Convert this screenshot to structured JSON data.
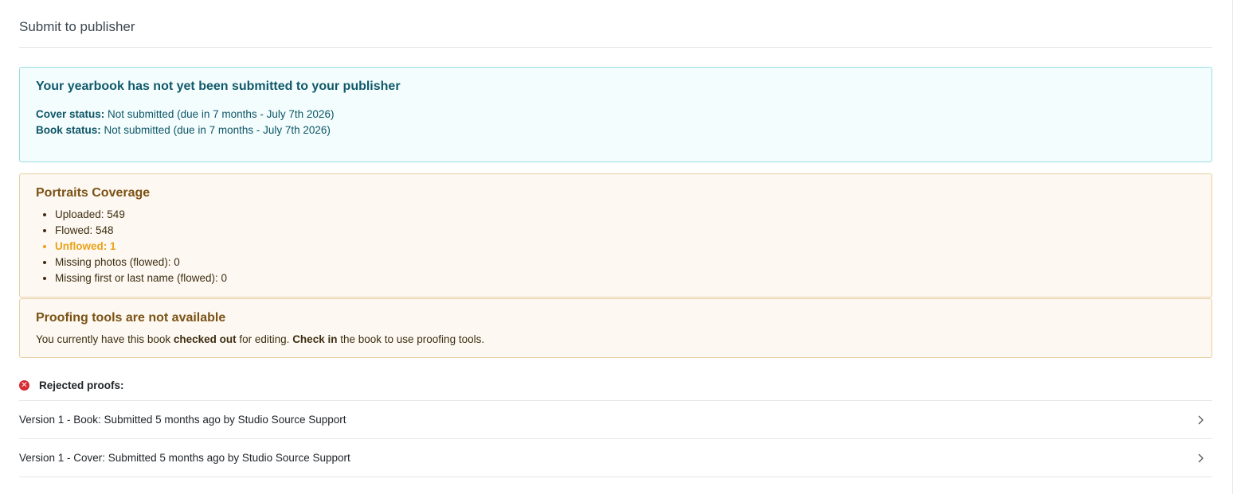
{
  "page": {
    "title": "Submit to publisher"
  },
  "submission": {
    "heading": "Your yearbook has not yet been submitted to your publisher",
    "cover_label": "Cover status:",
    "cover_value": "Not submitted (due in 7 months - July 7th 2026)",
    "book_label": "Book status:",
    "book_value": "Not submitted (due in 7 months - July 7th 2026)"
  },
  "coverage": {
    "heading": "Portraits Coverage",
    "items": [
      {
        "text": "Uploaded: 549"
      },
      {
        "text": "Flowed: 548"
      },
      {
        "text": "Unflowed: 1"
      },
      {
        "text": "Missing photos (flowed): 0"
      },
      {
        "text": "Missing first or last name (flowed): 0"
      }
    ]
  },
  "proofing": {
    "heading": "Proofing tools are not available",
    "text_1": "You currently have this book ",
    "strong_1": "checked out",
    "text_2": " for editing. ",
    "strong_2": "Check in",
    "text_3": " the book to use proofing tools."
  },
  "rejected": {
    "label": "Rejected proofs:",
    "icon": "error-circle-icon",
    "rows": [
      {
        "text": "Version 1 - Book: Submitted 5 months ago by Studio Source Support"
      },
      {
        "text": "Version 1 - Cover: Submitted 5 months ago by Studio Source Support"
      }
    ]
  },
  "colors": {
    "info_bg": "#f3fdfe",
    "info_border": "#9bdde3",
    "warn_bg": "#fdf8f1",
    "warn_border": "#e8cfa4",
    "unflowed": "#e9a21a",
    "error": "#d62b33"
  }
}
